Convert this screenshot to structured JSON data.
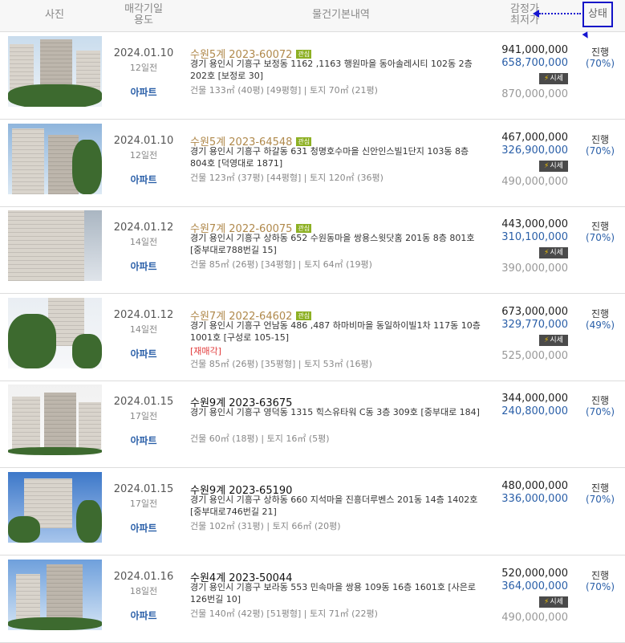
{
  "header": {
    "photo": "사진",
    "date_l1": "매각기일",
    "date_l2": "용도",
    "info": "물건기본내역",
    "price_l1": "감정가",
    "price_l2": "최저가",
    "status": "상태"
  },
  "colors": {
    "accent_blue": "#2a5fa8",
    "case_gold": "#b0894c",
    "interest_badge": "#8db023",
    "reauction_red": "#e23b3b",
    "annotation_blue": "#1515d0"
  },
  "rows": [
    {
      "date": "2024.01.10",
      "ago": "12일전",
      "type": "아파트",
      "case": "수원5계 2023-60072",
      "case_style": "gold",
      "badge": "관심",
      "address": "경기 용인시 기흥구 보정동 1162 ,1163 행원마을 동아솔레시티 102동 2층 202호 [보정로 30]",
      "note": "",
      "area": "건물 133㎡ (40평) [49평형]  |  토지 70㎡ (21평)",
      "appraise": "941,000,000",
      "min": "658,700,000",
      "market": "시세",
      "estimate": "870,000,000",
      "status": "진행",
      "rate": "(70%)"
    },
    {
      "date": "2024.01.10",
      "ago": "12일전",
      "type": "아파트",
      "case": "수원5계 2023-64548",
      "case_style": "gold",
      "badge": "관심",
      "address": "경기 용인시 기흥구 하갈동 631 청명호수마을 신안인스빌1단지 103동 8층 804호 [덕영대로 1871]",
      "note": "",
      "area": "건물 123㎡ (37평) [44평형]  |  토지 120㎡ (36평)",
      "appraise": "467,000,000",
      "min": "326,900,000",
      "market": "시세",
      "estimate": "490,000,000",
      "status": "진행",
      "rate": "(70%)"
    },
    {
      "date": "2024.01.12",
      "ago": "14일전",
      "type": "아파트",
      "case": "수원7계 2022-60075",
      "case_style": "gold",
      "badge": "관심",
      "address": "경기 용인시 기흥구 상하동 652 수원동마을 쌍용스윗닷홈 201동 8층 801호 [중부대로788번길 15]",
      "note": "",
      "area": "건물 85㎡ (26평) [34평형]  |  토지 64㎡ (19평)",
      "appraise": "443,000,000",
      "min": "310,100,000",
      "market": "시세",
      "estimate": "390,000,000",
      "status": "진행",
      "rate": "(70%)"
    },
    {
      "date": "2024.01.12",
      "ago": "14일전",
      "type": "아파트",
      "case": "수원7계 2022-64602",
      "case_style": "gold",
      "badge": "관심",
      "address": "경기 용인시 기흥구 언남동 486 ,487 하마비마을 동일하이빌1차 117동 10층 1001호 [구성로 105-15]",
      "note": "[재매각]",
      "area": "건물 85㎡ (26평) [35평형]  |  토지 53㎡ (16평)",
      "appraise": "673,000,000",
      "min": "329,770,000",
      "market": "시세",
      "estimate": "525,000,000",
      "status": "진행",
      "rate": "(49%)"
    },
    {
      "date": "2024.01.15",
      "ago": "17일전",
      "type": "아파트",
      "case": "수원9계 2023-63675",
      "case_style": "black",
      "badge": "",
      "address": "경기 용인시 기흥구 영덕동 1315 힉스유타워 C동 3층 309호 [중부대로 184]",
      "note": "",
      "area": "건물 60㎡ (18평)  |  토지 16㎡ (5평)",
      "appraise": "344,000,000",
      "min": "240,800,000",
      "market": "",
      "estimate": "",
      "status": "진행",
      "rate": "(70%)"
    },
    {
      "date": "2024.01.15",
      "ago": "17일전",
      "type": "아파트",
      "case": "수원9계 2023-65190",
      "case_style": "black",
      "badge": "",
      "address": "경기 용인시 기흥구 상하동 660 지석마을 진흥더루벤스 201동 14층 1402호 [중부대로746번길 21]",
      "note": "",
      "area": "건물 102㎡ (31평)  |  토지 66㎡ (20평)",
      "appraise": "480,000,000",
      "min": "336,000,000",
      "market": "",
      "estimate": "",
      "status": "진행",
      "rate": "(70%)"
    },
    {
      "date": "2024.01.16",
      "ago": "18일전",
      "type": "아파트",
      "case": "수원4계 2023-50044",
      "case_style": "black",
      "badge": "",
      "address": "경기 용인시 기흥구 보라동 553 민속마을 쌍용 109동 16층 1601호 [사은로126번길 10]",
      "note": "",
      "area": "건물 140㎡ (42평) [51평형]  |  토지 71㎡ (22평)",
      "appraise": "520,000,000",
      "min": "364,000,000",
      "market": "시세",
      "estimate": "490,000,000",
      "status": "진행",
      "rate": "(70%)"
    }
  ]
}
